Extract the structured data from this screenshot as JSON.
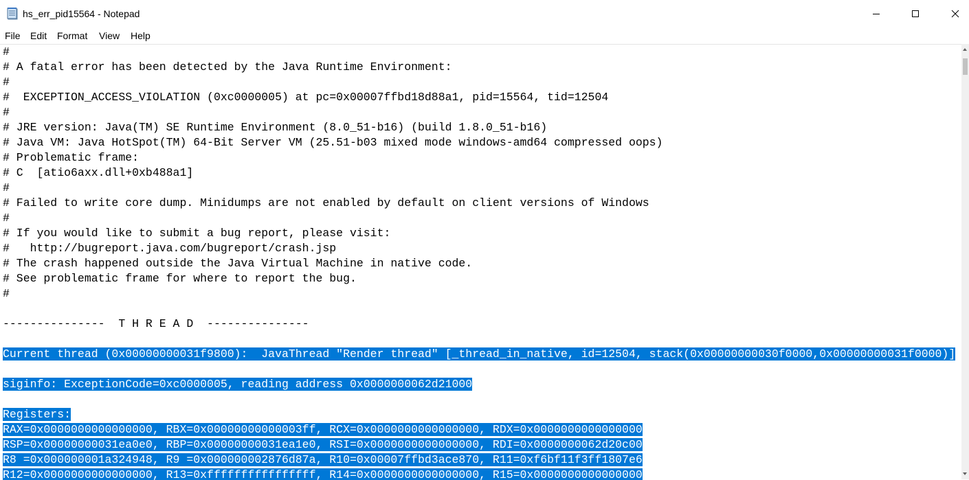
{
  "window": {
    "title": "hs_err_pid15564 - Notepad",
    "icon": "notepad-icon",
    "controls": [
      "minimize-icon",
      "maximize-icon",
      "close-icon"
    ]
  },
  "menu": {
    "file": "File",
    "edit": "Edit",
    "format": "Format",
    "view": "View",
    "help": "Help"
  },
  "editor": {
    "selection_color": "#0078d7",
    "lines": [
      "#",
      "# A fatal error has been detected by the Java Runtime Environment:",
      "#",
      "#  EXCEPTION_ACCESS_VIOLATION (0xc0000005) at pc=0x00007ffbd18d88a1, pid=15564, tid=12504",
      "#",
      "# JRE version: Java(TM) SE Runtime Environment (8.0_51-b16) (build 1.8.0_51-b16)",
      "# Java VM: Java HotSpot(TM) 64-Bit Server VM (25.51-b03 mixed mode windows-amd64 compressed oops)",
      "# Problematic frame:",
      "# C  [atio6axx.dll+0xb488a1]",
      "#",
      "# Failed to write core dump. Minidumps are not enabled by default on client versions of Windows",
      "#",
      "# If you would like to submit a bug report, please visit:",
      "#   http://bugreport.java.com/bugreport/crash.jsp",
      "# The crash happened outside the Java Virtual Machine in native code.",
      "# See problematic frame for where to report the bug.",
      "#",
      "",
      "---------------  T H R E A D  ---------------",
      "",
      "Current thread (0x00000000031f9800):  JavaThread \"Render thread\" [_thread_in_native, id=12504, stack(0x00000000030f0000,0x00000000031f0000)]",
      "",
      "siginfo: ExceptionCode=0xc0000005, reading address 0x0000000062d21000",
      "",
      "Registers:",
      "RAX=0x0000000000000000, RBX=0x00000000000003ff, RCX=0x0000000000000000, RDX=0x0000000000000000",
      "RSP=0x00000000031ea0e0, RBP=0x00000000031ea1e0, RSI=0x0000000000000000, RDI=0x0000000062d20c00",
      "R8 =0x000000001a324948, R9 =0x000000002876d87a, R10=0x00007ffbd3ace870, R11=0xf6bf11f3ff1807e6",
      "R12=0x0000000000000000, R13=0xffffffffffffffff, R14=0x0000000000000000, R15=0x0000000000000000"
    ]
  }
}
